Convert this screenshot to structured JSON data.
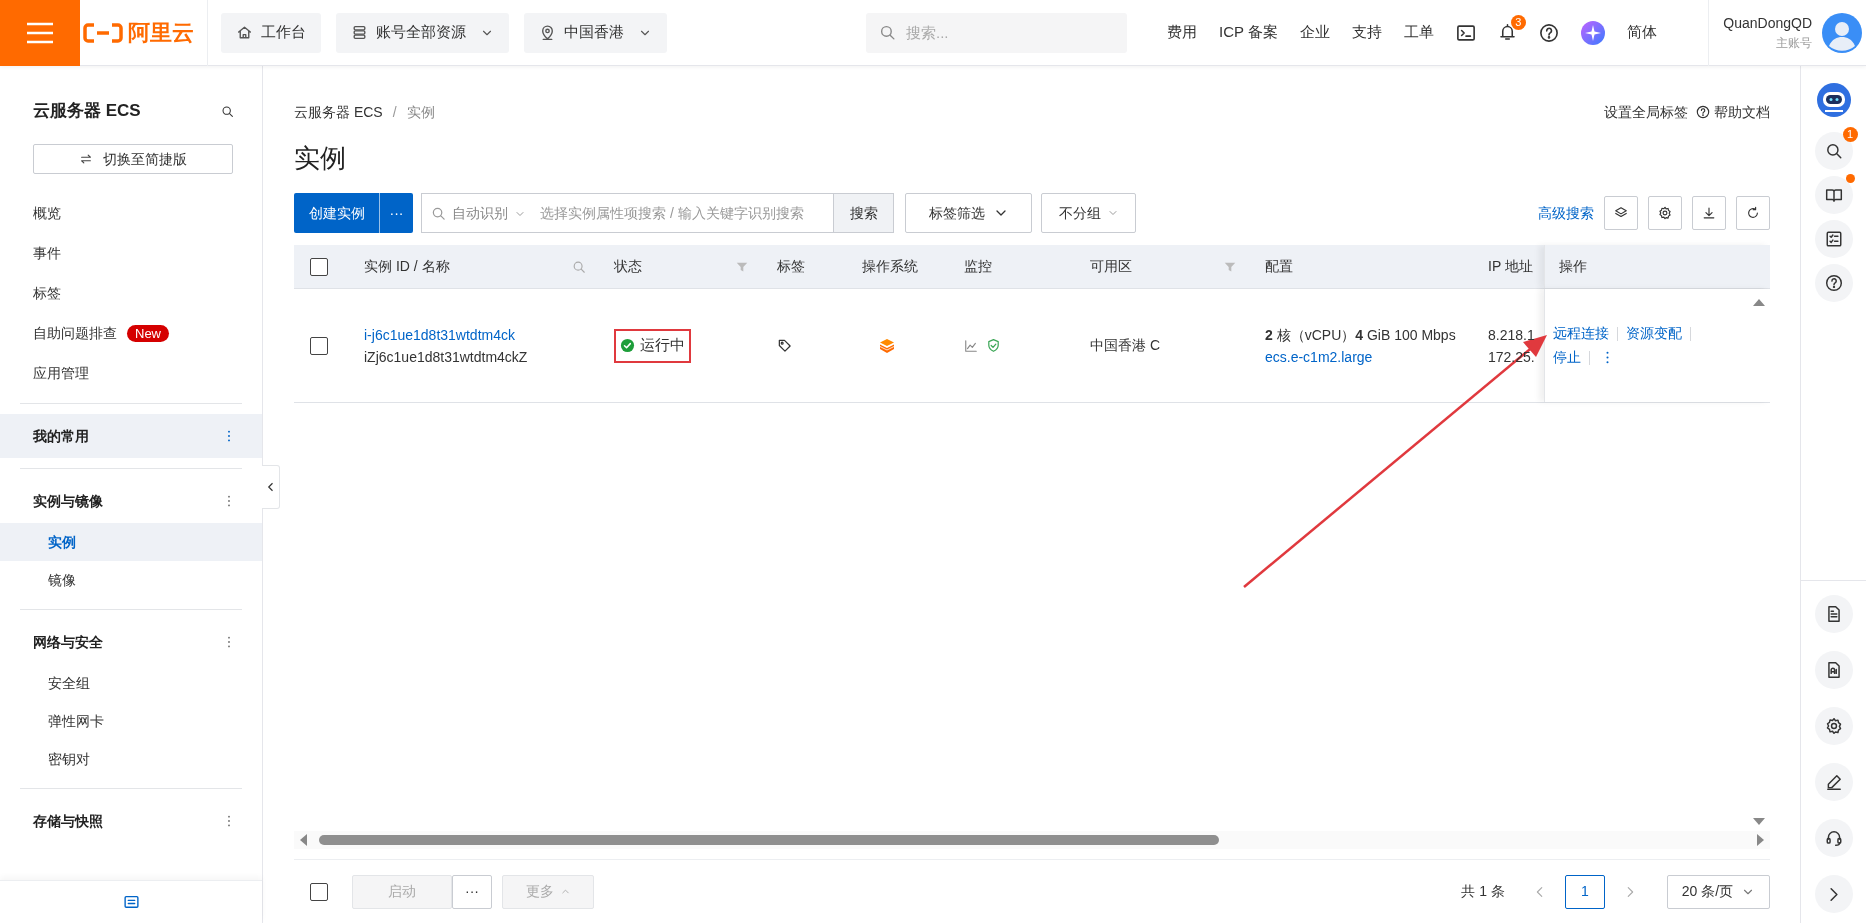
{
  "topbar": {
    "logo": "阿里云",
    "nav": [
      {
        "kind": "home",
        "label": "工作台",
        "dropdown": false
      },
      {
        "kind": "resources",
        "label": "账号全部资源",
        "dropdown": true
      },
      {
        "kind": "location",
        "label": "中国香港",
        "dropdown": true
      }
    ],
    "search": {
      "placeholder": "搜索..."
    },
    "links": [
      "费用",
      "ICP 备案",
      "企业",
      "支持",
      "工单"
    ],
    "notification_count": "3",
    "language": "简体",
    "user": {
      "name": "QuanDongQD",
      "role": "主账号"
    }
  },
  "sidebar": {
    "title": "云服务器 ECS",
    "switch_button": "切换至简捷版",
    "items": [
      {
        "label": "概览",
        "selected": false
      },
      {
        "label": "事件",
        "selected": false
      },
      {
        "label": "标签",
        "selected": false
      },
      {
        "label": "自助问题排查",
        "badge": "New",
        "selected": false
      },
      {
        "label": "应用管理",
        "selected": false
      }
    ],
    "groups": [
      {
        "title": "我的常用",
        "highlighted": true
      },
      {
        "title": "实例与镜像",
        "highlighted": false,
        "children": [
          {
            "label": "实例",
            "selected": true
          },
          {
            "label": "镜像",
            "selected": false
          }
        ]
      },
      {
        "title": "网络与安全",
        "highlighted": false,
        "children": [
          {
            "label": "安全组",
            "selected": false
          },
          {
            "label": "弹性网卡",
            "selected": false
          },
          {
            "label": "密钥对",
            "selected": false
          }
        ]
      },
      {
        "title": "存储与快照",
        "highlighted": false
      }
    ]
  },
  "page": {
    "breadcrumb": [
      "云服务器 ECS",
      "实例"
    ],
    "breadcrumb_separator": "/",
    "header_links": [
      "设置全局标签",
      "帮助文档"
    ],
    "title": "实例",
    "toolbar": {
      "create_button": "创建实例",
      "more_button": "···",
      "search_scope": "自动识别",
      "search_placeholder": "选择实例属性项搜索 / 输入关键字识别搜索",
      "search_button": "搜索",
      "tag_filter": "标签筛选",
      "grouping": "不分组",
      "advanced_search": "高级搜索"
    },
    "table": {
      "select_all_checked": false,
      "columns": [
        {
          "label": "实例 ID / 名称",
          "search": true,
          "filter": false
        },
        {
          "label": "状态",
          "search": false,
          "filter": true
        },
        {
          "label": "标签",
          "search": false,
          "filter": false
        },
        {
          "label": "操作系统",
          "search": false,
          "filter": false
        },
        {
          "label": "监控",
          "search": false,
          "filter": false
        },
        {
          "label": "可用区",
          "search": false,
          "filter": true
        },
        {
          "label": "配置",
          "search": false,
          "filter": false
        },
        {
          "label": "IP 地址",
          "search": false,
          "filter": false
        },
        {
          "label": "操作",
          "search": false,
          "filter": false
        }
      ],
      "rows": [
        {
          "checked": false,
          "id": "i-j6c1ue1d8t31wtdtm4ck",
          "name": "iZj6c1ue1d8t31wtdtm4ckZ",
          "status": "运行中",
          "status_boxed": true,
          "zone": "中国香港 C",
          "config": "**2** 核（vCPU）**4** GiB 100 Mbps",
          "instance_type": "ecs.e-c1m2.large",
          "ip_addresses": [
            "8.218.1",
            "172.25."
          ],
          "actions": [
            "远程连接",
            "资源变配",
            "停止"
          ]
        }
      ]
    },
    "footer": {
      "select_all_checked": false,
      "buttons": [
        {
          "label": "启动",
          "disabled": true
        },
        {
          "label": "···",
          "disabled": false
        },
        {
          "label": "更多",
          "disabled": true
        }
      ],
      "total": "共 1 条",
      "pages": [
        {
          "label": "1",
          "selected": true
        }
      ],
      "page_size": "20 条/页"
    }
  },
  "right_rail": {
    "search_badge": "1",
    "book_dot": true
  },
  "annotation": {
    "arrow": true
  }
}
